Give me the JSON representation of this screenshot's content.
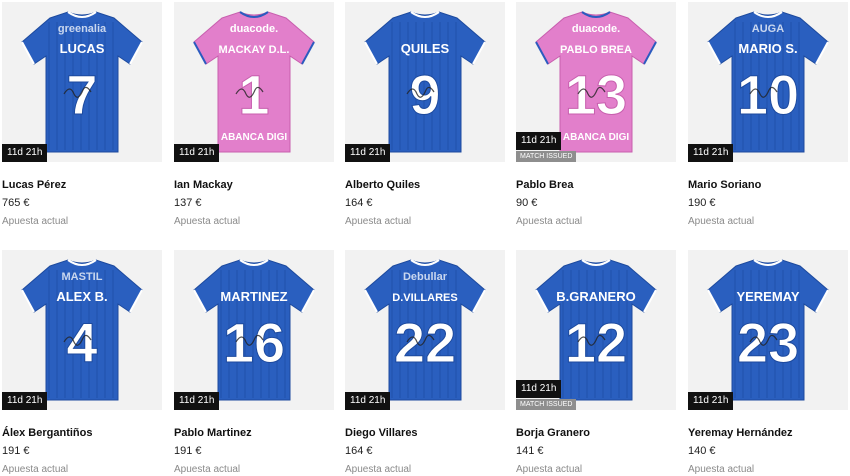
{
  "colors": {
    "blue_kit": "#2a5fbf",
    "pink_kit": "#e27fcb",
    "timer_bg": "#111111",
    "badge_bg": "#8e8e8e"
  },
  "items": [
    {
      "name": "Lucas Pérez",
      "price": "765 €",
      "status": "Apuesta actual",
      "timer": "11d 21h",
      "badge": "",
      "kit": "blue",
      "shirt_name": "LUCAS",
      "shirt_number": "7",
      "sponsor_top": "greenalia",
      "sponsor_bottom": ""
    },
    {
      "name": "Ian Mackay",
      "price": "137 €",
      "status": "Apuesta actual",
      "timer": "11d 21h",
      "badge": "",
      "kit": "pink",
      "shirt_name": "MACKAY D.L.",
      "shirt_number": "1",
      "sponsor_top": "duacode.",
      "sponsor_bottom": "ABANCA DIGI"
    },
    {
      "name": "Alberto Quiles",
      "price": "164 €",
      "status": "Apuesta actual",
      "timer": "11d 21h",
      "badge": "",
      "kit": "blue",
      "shirt_name": "QUILES",
      "shirt_number": "9",
      "sponsor_top": "",
      "sponsor_bottom": ""
    },
    {
      "name": "Pablo Brea",
      "price": "90 €",
      "status": "Apuesta actual",
      "timer": "11d 21h",
      "badge": "MATCH ISSUED",
      "kit": "pink",
      "shirt_name": "PABLO BREA",
      "shirt_number": "13",
      "sponsor_top": "duacode.",
      "sponsor_bottom": "ABANCA DIGI"
    },
    {
      "name": "Mario Soriano",
      "price": "190 €",
      "status": "Apuesta actual",
      "timer": "11d 21h",
      "badge": "",
      "kit": "blue",
      "shirt_name": "MARIO S.",
      "shirt_number": "10",
      "sponsor_top": "AUGA",
      "sponsor_bottom": ""
    },
    {
      "name": "Álex Bergantiños",
      "price": "191 €",
      "status": "Apuesta actual",
      "timer": "11d 21h",
      "badge": "",
      "kit": "blue",
      "shirt_name": "ALEX B.",
      "shirt_number": "4",
      "sponsor_top": "MASTIL",
      "sponsor_bottom": ""
    },
    {
      "name": "Pablo Martinez",
      "price": "191 €",
      "status": "Apuesta actual",
      "timer": "11d 21h",
      "badge": "",
      "kit": "blue",
      "shirt_name": "MARTINEZ",
      "shirt_number": "16",
      "sponsor_top": "",
      "sponsor_bottom": ""
    },
    {
      "name": "Diego Villares",
      "price": "164 €",
      "status": "Apuesta actual",
      "timer": "11d 21h",
      "badge": "",
      "kit": "blue",
      "shirt_name": "D.VILLARES",
      "shirt_number": "22",
      "sponsor_top": "Debullar",
      "sponsor_bottom": ""
    },
    {
      "name": "Borja Granero",
      "price": "141 €",
      "status": "Apuesta actual",
      "timer": "11d 21h",
      "badge": "MATCH ISSUED",
      "kit": "blue",
      "shirt_name": "B.GRANERO",
      "shirt_number": "12",
      "sponsor_top": "",
      "sponsor_bottom": ""
    },
    {
      "name": "Yeremay Hernández",
      "price": "140 €",
      "status": "Apuesta actual",
      "timer": "11d 21h",
      "badge": "",
      "kit": "blue",
      "shirt_name": "YEREMAY",
      "shirt_number": "23",
      "sponsor_top": "",
      "sponsor_bottom": ""
    }
  ]
}
